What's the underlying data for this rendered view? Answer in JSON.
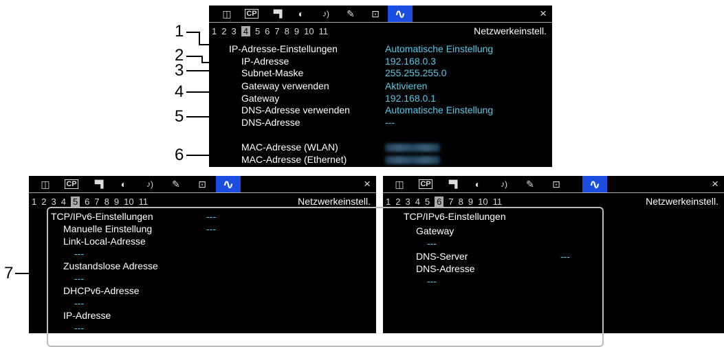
{
  "tabs": [
    {
      "icon": "image-icon",
      "glyph": "◫"
    },
    {
      "icon": "custom-picture-icon",
      "glyph": "CP"
    },
    {
      "icon": "camera-icon",
      "glyph": "▝▜"
    },
    {
      "icon": "recording-icon",
      "glyph": "◐"
    },
    {
      "icon": "audio-icon",
      "glyph": "♪)"
    },
    {
      "icon": "wrench-icon",
      "glyph": "✎"
    },
    {
      "icon": "assign-icon",
      "glyph": "⊡"
    },
    {
      "icon": "network-icon",
      "glyph": "∿"
    }
  ],
  "close_glyph": "×",
  "page_numbers": [
    "1",
    "2",
    "3",
    "4",
    "5",
    "6",
    "7",
    "8",
    "9",
    "10",
    "11"
  ],
  "menu_title": "Netzwerkeinstell.",
  "panel1": {
    "current_page": "4",
    "rows": [
      {
        "label": "IP-Adresse-Einstellungen",
        "value": "Automatische Einstellung"
      },
      {
        "label": "IP-Adresse",
        "value": "192.168.0.3"
      },
      {
        "label": "Subnet-Maske",
        "value": "255.255.255.0"
      },
      {
        "label": "Gateway verwenden",
        "value": "Aktivieren"
      },
      {
        "label": "Gateway",
        "value": "192.168.0.1"
      },
      {
        "label": "DNS-Adresse verwenden",
        "value": "Automatische Einstellung"
      },
      {
        "label": "DNS-Adresse",
        "value": "---"
      },
      {
        "label": "MAC-Adresse (WLAN)",
        "value": ""
      },
      {
        "label": "MAC-Adresse (Ethernet)",
        "value": ""
      }
    ]
  },
  "panel2": {
    "current_page": "5",
    "rows": [
      {
        "label": "TCP/IPv6-Einstellungen",
        "value": "---"
      },
      {
        "label": "Manuelle Einstellung",
        "value": "---"
      },
      {
        "label": "Link-Local-Adresse",
        "value": ""
      },
      {
        "label": "",
        "value": "---"
      },
      {
        "label": "Zustandslose Adresse",
        "value": ""
      },
      {
        "label": "",
        "value": "---"
      },
      {
        "label": "DHCPv6-Adresse",
        "value": ""
      },
      {
        "label": "",
        "value": "---"
      },
      {
        "label": "IP-Adresse",
        "value": ""
      },
      {
        "label": "",
        "value": "---"
      }
    ]
  },
  "panel3": {
    "current_page": "6",
    "rows": [
      {
        "label": "TCP/IPv6-Einstellungen",
        "value": ""
      },
      {
        "label": "Gateway",
        "value": ""
      },
      {
        "label": "",
        "value": "---"
      },
      {
        "label": "DNS-Server",
        "value": "---"
      },
      {
        "label": "DNS-Adresse",
        "value": ""
      },
      {
        "label": "",
        "value": "---"
      }
    ]
  },
  "callouts": [
    "1",
    "2",
    "3",
    "4",
    "5",
    "6",
    "7"
  ]
}
